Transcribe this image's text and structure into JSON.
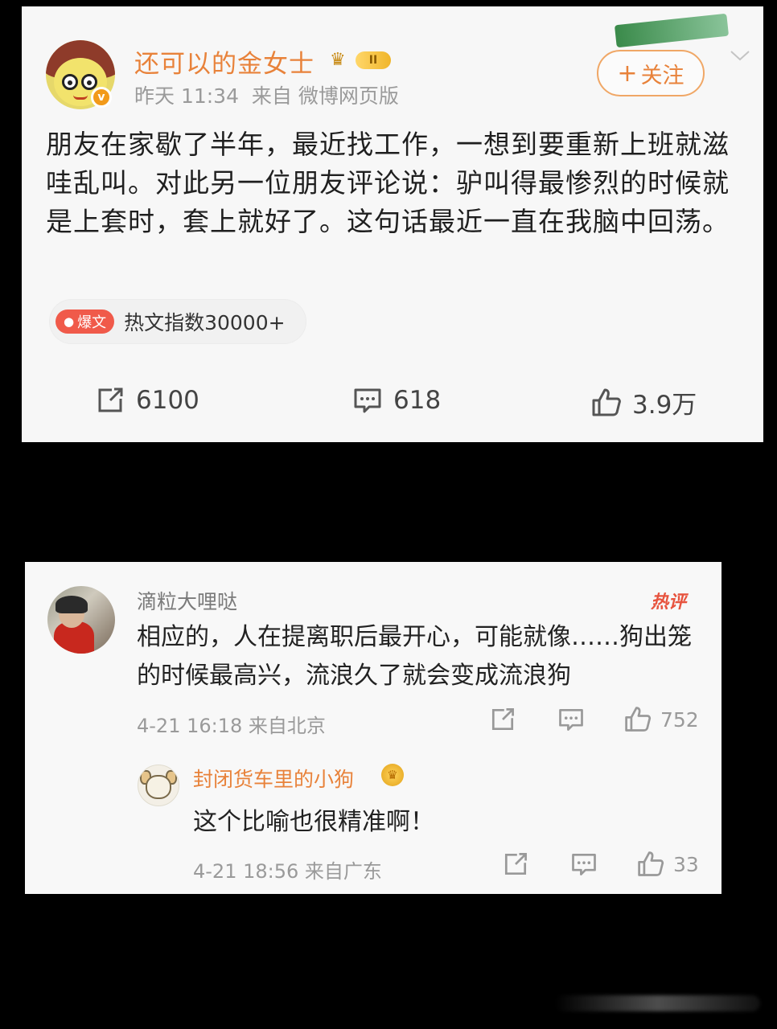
{
  "post": {
    "username": "还可以的金女士",
    "vip_level": "II",
    "verified_mark": "v",
    "time": "昨天 11:34",
    "source": "来自 微博网页版",
    "follow_label": "关注",
    "text": "朋友在家歇了半年，最近找工作，一想到要重新上班就滋哇乱叫。对此另一位朋友评论说：驴叫得最惨烈的时候就是上套时，套上就好了。这句话最近一直在我脑中回荡。",
    "hot_tag_label": "爆文",
    "hot_index": "热文指数30000+",
    "reposts": "6100",
    "comments": "618",
    "likes": "3.9万"
  },
  "comment": {
    "username": "滴粒大哩哒",
    "hot_badge": "热评",
    "text": "相应的，人在提离职后最开心，可能就像……狗出笼的时候最高兴，流浪久了就会变成流浪狗",
    "time": "4-21 16:18",
    "source": "来自北京",
    "likes": "752"
  },
  "reply": {
    "username": "封闭货车里的小狗",
    "text": "这个比喻也很精准啊！",
    "time": "4-21 18:56",
    "source": "来自广东",
    "likes": "33"
  },
  "colors": {
    "username_orange": "#e8823a",
    "hot_red": "#f05a4a",
    "text_dark": "#1f1f1f",
    "meta_gray": "#9a9a9a"
  },
  "icons": [
    "verified-icon",
    "crown-icon",
    "repost-icon",
    "comment-icon",
    "like-icon",
    "chevron-down-icon",
    "flame-icon"
  ]
}
